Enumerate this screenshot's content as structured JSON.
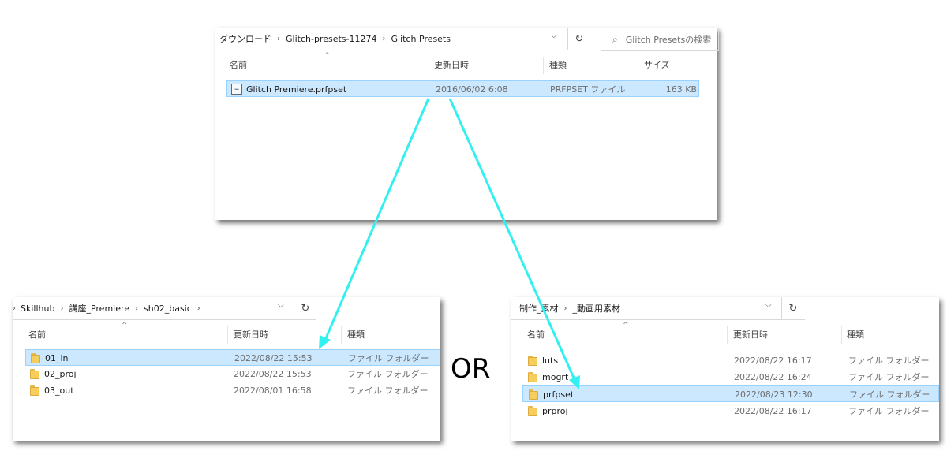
{
  "top_window": {
    "address": [
      "ダウンロード",
      "Glitch-presets-11274",
      "Glitch Presets"
    ],
    "search_placeholder": "Glitch Presetsの検索",
    "columns": [
      "名前",
      "更新日時",
      "種類",
      "サイズ"
    ],
    "file": {
      "name": "Glitch Premiere.prfpset",
      "date": "2016/06/02 6:08",
      "type": "PRFPSET ファイル",
      "size": "163 KB"
    }
  },
  "left_window": {
    "address": [
      "Skillhub",
      "講座_Premiere",
      "sh02_basic"
    ],
    "columns": [
      "名前",
      "更新日時",
      "種類"
    ],
    "rows": [
      {
        "name": "01_in",
        "date": "2022/08/22 15:53",
        "type": "ファイル フォルダー"
      },
      {
        "name": "02_proj",
        "date": "2022/08/22 15:53",
        "type": "ファイル フォルダー"
      },
      {
        "name": "03_out",
        "date": "2022/08/01 16:58",
        "type": "ファイル フォルダー"
      }
    ]
  },
  "right_window": {
    "address": [
      "制作_素材",
      "_動画用素材"
    ],
    "columns": [
      "名前",
      "更新日時",
      "種類"
    ],
    "rows": [
      {
        "name": "luts",
        "date": "2022/08/22 16:17",
        "type": "ファイル フォルダー"
      },
      {
        "name": "mogrt",
        "date": "2022/08/22 16:24",
        "type": "ファイル フォルダー"
      },
      {
        "name": "prfpset",
        "date": "2022/08/23 12:30",
        "type": "ファイル フォルダー"
      },
      {
        "name": "prproj",
        "date": "2022/08/22 16:17",
        "type": "ファイル フォルダー"
      }
    ]
  },
  "or_label": "OR",
  "icons": {
    "dropdown": "chevron-down-icon",
    "refresh": "refresh-icon",
    "search": "search-icon",
    "folder": "folder-icon",
    "preset_file": "preset-file-icon",
    "sort": "sort-ascending-icon"
  },
  "colors": {
    "arrow": "#33f0f0",
    "selection": "#cce8ff",
    "selection_border": "#99d1ff",
    "folder": "#f7cd5c"
  }
}
